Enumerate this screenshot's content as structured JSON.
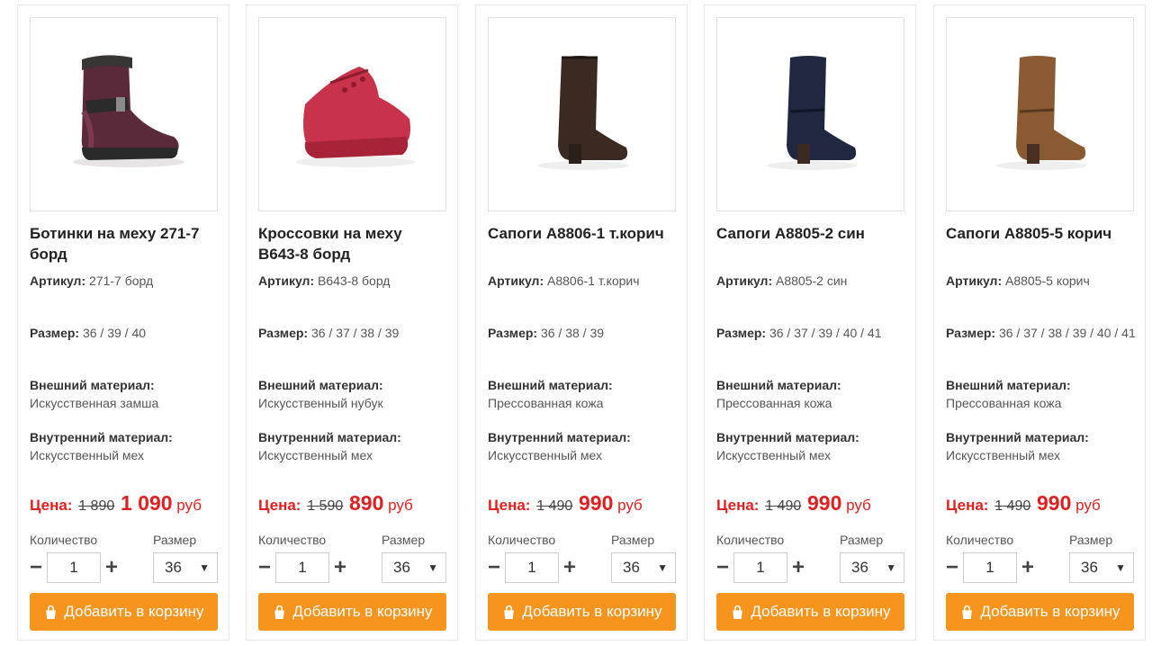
{
  "labels": {
    "article": "Артикул:",
    "size": "Размер:",
    "outer_material": "Внешний материал:",
    "inner_material": "Внутренний материал:",
    "price": "Цена:",
    "currency": "руб",
    "quantity": "Количество",
    "size_select": "Размер",
    "minus": "−",
    "plus": "+",
    "add_to_cart": "Добавить в корзину"
  },
  "products": [
    {
      "image_icon": "purple-ankle-boot-image",
      "title": "Ботинки на меху 271-7 борд",
      "article": "271-7 борд",
      "sizes": "36 / 39 / 40",
      "outer_material": "Искусственная замша",
      "inner_material": "Искусственный мех",
      "old_price": "1 890",
      "new_price": "1 090",
      "quantity": "1",
      "selected_size": "36"
    },
    {
      "image_icon": "red-sneaker-image",
      "title": "Кроссовки на меху B643-8 борд",
      "article": "B643-8 борд",
      "sizes": "36 / 37 / 38 / 39",
      "outer_material": "Искусственный нубук",
      "inner_material": "Искусственный мех",
      "old_price": "1 590",
      "new_price": "890",
      "quantity": "1",
      "selected_size": "36"
    },
    {
      "image_icon": "dark-brown-boot-image",
      "title": "Сапоги A8806-1 т.корич",
      "article": "A8806-1 т.корич",
      "sizes": "36 / 38 / 39",
      "outer_material": "Прессованная кожа",
      "inner_material": "Искусственный мех",
      "old_price": "1 490",
      "new_price": "990",
      "quantity": "1",
      "selected_size": "36"
    },
    {
      "image_icon": "navy-boot-image",
      "title": "Сапоги A8805-2 син",
      "article": "A8805-2 син",
      "sizes": "36 / 37 / 39 / 40 / 41",
      "outer_material": "Прессованная кожа",
      "inner_material": "Искусственный мех",
      "old_price": "1 490",
      "new_price": "990",
      "quantity": "1",
      "selected_size": "36"
    },
    {
      "image_icon": "brown-boot-image",
      "title": "Сапоги A8805-5 корич",
      "article": "A8805-5 корич",
      "sizes": "36 / 37 / 38 / 39 / 40 / 41",
      "outer_material": "Прессованная кожа",
      "inner_material": "Искусственный мех",
      "old_price": "1 490",
      "new_price": "990",
      "quantity": "1",
      "selected_size": "36"
    }
  ],
  "colors": {
    "accent_button": "#f7941d",
    "price_red": "#e02020"
  }
}
